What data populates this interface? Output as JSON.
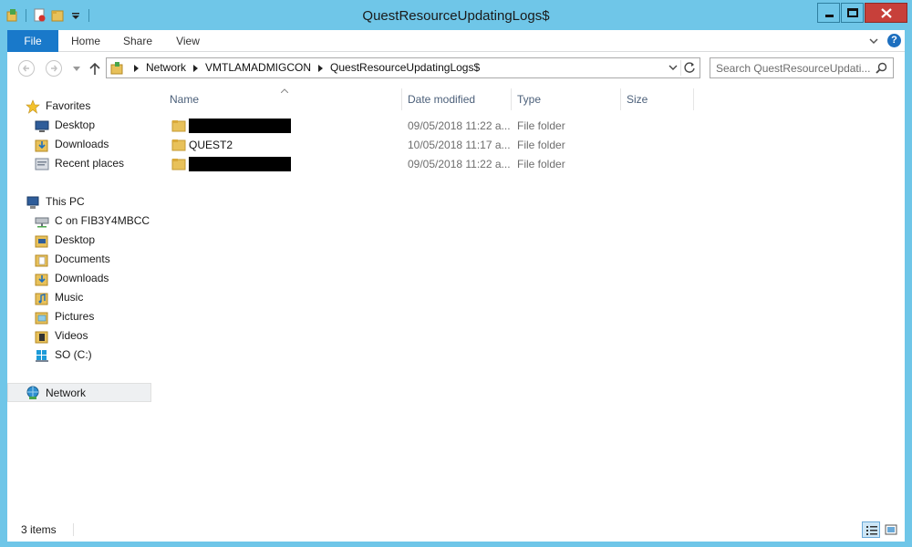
{
  "window": {
    "title": "QuestResourceUpdatingLogs$"
  },
  "quick_access": {
    "icons": [
      "properties-icon",
      "new-folder-icon",
      "customize-dropdown-icon"
    ]
  },
  "ribbon": {
    "tabs": [
      "File",
      "Home",
      "Share",
      "View"
    ],
    "help_label": "?"
  },
  "address": {
    "crumbs": [
      "Network",
      "VMTLAMADMIGCON",
      "QuestResourceUpdatingLogs$"
    ]
  },
  "search": {
    "placeholder": "Search QuestResourceUpdati..."
  },
  "navigation": {
    "favorites": {
      "label": "Favorites",
      "items": [
        "Desktop",
        "Downloads",
        "Recent places"
      ]
    },
    "this_pc": {
      "label": "This PC",
      "items": [
        "C on FIB3Y4MBCC",
        "Desktop",
        "Documents",
        "Downloads",
        "Music",
        "Pictures",
        "Videos",
        "SO (C:)"
      ]
    },
    "network": {
      "label": "Network"
    }
  },
  "columns": [
    "Name",
    "Date modified",
    "Type",
    "Size"
  ],
  "files": [
    {
      "name": "",
      "redacted": true,
      "date": "09/05/2018 11:22 a...",
      "type": "File folder"
    },
    {
      "name": "QUEST2",
      "redacted": false,
      "date": "10/05/2018 11:17 a...",
      "type": "File folder"
    },
    {
      "name": "",
      "redacted": true,
      "date": "09/05/2018 11:22 a...",
      "type": "File folder"
    }
  ],
  "status": {
    "count": "3 items"
  },
  "colors": {
    "titlebar": "#6fc6e8",
    "file_tab": "#1979ca",
    "close_button": "#c7403a",
    "folder": "#e8c15a"
  }
}
